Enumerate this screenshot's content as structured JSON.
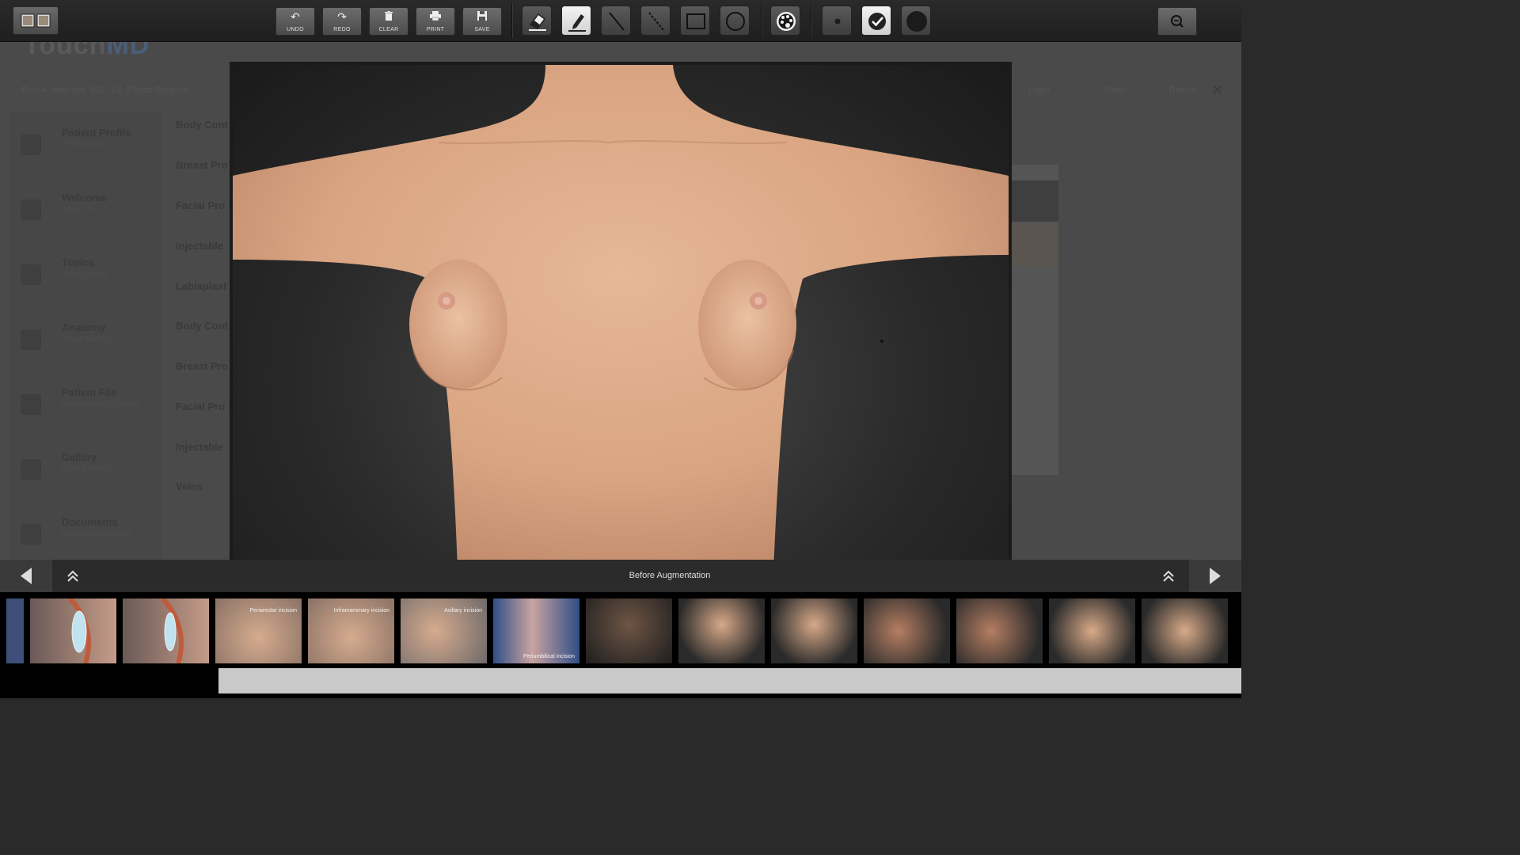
{
  "background": {
    "logo_a": "Touch",
    "logo_b": "MD",
    "doctor": "Rion A. Maercks, MD - VZ: Plastic Surgeon",
    "nav": [
      "Login",
      "Menu",
      "Return"
    ],
    "close": "✕",
    "sidebar": [
      {
        "title": "Patient Profile",
        "sub": "Preferences"
      },
      {
        "title": "Welcome",
        "sub": "About Us"
      },
      {
        "title": "Topics",
        "sub": "Video Library"
      },
      {
        "title": "Anatomy",
        "sub": "Image Library"
      },
      {
        "title": "Patient File",
        "sub": "Personalized Content"
      },
      {
        "title": "Gallery",
        "sub": "Case Studies"
      },
      {
        "title": "Documents",
        "sub": "General Information"
      }
    ],
    "categories": [
      "Body Cont",
      "Breast Pro",
      "Facial Pro",
      "Injectable",
      "Labiaplast",
      "Body Cont",
      "Breast Pro",
      "Facial Pro",
      "Injectable",
      "Veins"
    ]
  },
  "toolbar": {
    "undo": "UNDO",
    "redo": "REDO",
    "clear": "CLEAR",
    "print": "PRINT",
    "save": "SAVE"
  },
  "viewer": {
    "caption": "Before Augmentation"
  },
  "thumbnails": [
    {
      "label": ""
    },
    {
      "label": ""
    },
    {
      "label": "Periareolar incision"
    },
    {
      "label": "Inframammary incision"
    },
    {
      "label": "Axillary incision"
    },
    {
      "label": "Periumbilical incision"
    },
    {
      "label": ""
    },
    {
      "label": ""
    },
    {
      "label": ""
    },
    {
      "label": ""
    },
    {
      "label": ""
    },
    {
      "label": ""
    },
    {
      "label": ""
    }
  ]
}
